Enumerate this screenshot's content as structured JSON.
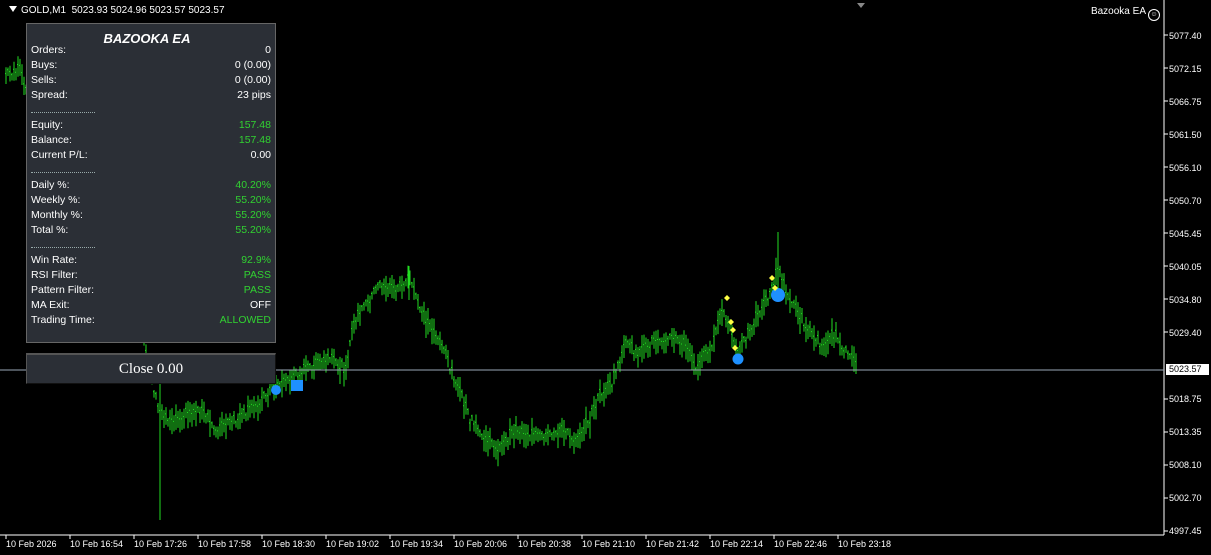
{
  "symbol_bar": {
    "symbol": "GOLD,M1",
    "quote": "5023.93 5024.96 5023.57 5023.57"
  },
  "ea_label": "Bazooka EA",
  "current_price": "5023.57",
  "y_axis_ticks": [
    "5077.40",
    "5072.15",
    "5066.75",
    "5061.50",
    "5056.10",
    "5050.70",
    "5045.45",
    "5040.05",
    "5034.80",
    "5029.40",
    "5023.57",
    "5018.75",
    "5013.35",
    "5008.10",
    "5002.70",
    "4997.45"
  ],
  "x_axis_ticks": [
    "10 Feb 2026",
    "10 Feb 16:54",
    "10 Feb 17:26",
    "10 Feb 17:58",
    "10 Feb 18:30",
    "10 Feb 19:02",
    "10 Feb 19:34",
    "10 Feb 20:06",
    "10 Feb 20:38",
    "10 Feb 21:10",
    "10 Feb 21:42",
    "10 Feb 22:14",
    "10 Feb 22:46",
    "10 Feb 23:18"
  ],
  "colors": {
    "bars": "#22dd22",
    "entry_marker": "#1e90ff",
    "arrow_marker": "#ffff44",
    "price_line": "#9aa7b8"
  },
  "panel": {
    "title": "BAZOOKA EA",
    "rows": [
      {
        "label": "Orders:",
        "value": "0",
        "green": false
      },
      {
        "label": "Buys:",
        "value": "0 (0.00)",
        "green": false
      },
      {
        "label": "Sells:",
        "value": "0 (0.00)",
        "green": false
      },
      {
        "label": "Spread:",
        "value": "23 pips",
        "green": false
      },
      {
        "separator": true
      },
      {
        "label": "Equity:",
        "value": "157.48",
        "green": true
      },
      {
        "label": "Balance:",
        "value": "157.48",
        "green": true
      },
      {
        "label": "Current P/L:",
        "value": "0.00",
        "green": false
      },
      {
        "separator": true
      },
      {
        "label": "Daily %:",
        "value": "40.20%",
        "green": true
      },
      {
        "label": "Weekly %:",
        "value": "55.20%",
        "green": true
      },
      {
        "label": "Monthly %:",
        "value": "55.20%",
        "green": true
      },
      {
        "label": "Total %:",
        "value": "55.20%",
        "green": true
      },
      {
        "separator": true
      },
      {
        "label": "Win Rate:",
        "value": "92.9%",
        "green": true
      },
      {
        "label": "RSI Filter:",
        "value": "PASS",
        "green": true
      },
      {
        "label": "Pattern Filter:",
        "value": "PASS",
        "green": true
      },
      {
        "label": "MA Exit:",
        "value": "OFF",
        "green": false
      },
      {
        "label": "Trading Time:",
        "value": "ALLOWED",
        "green": true
      }
    ]
  },
  "close_button": {
    "label": "Close 0.00"
  }
}
